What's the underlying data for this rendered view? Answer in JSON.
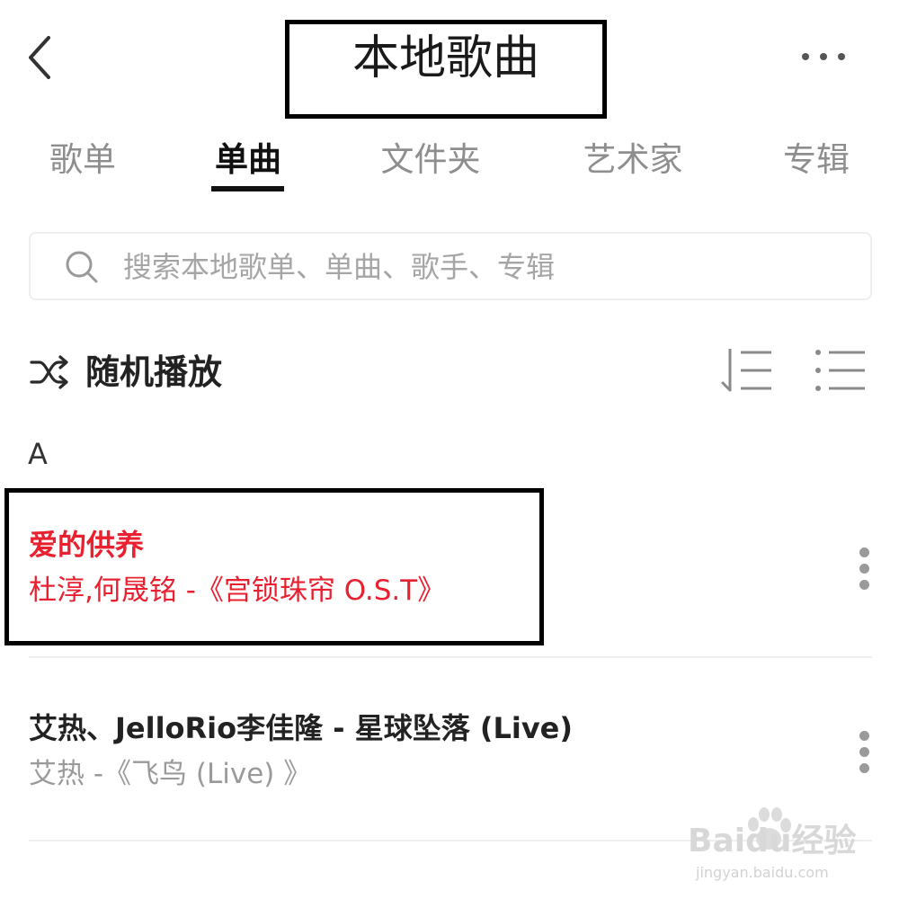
{
  "header": {
    "title": "本地歌曲",
    "back_icon": "chevron-left-icon",
    "more_icon": "more-horizontal-icon"
  },
  "tabs": [
    {
      "label": "歌单",
      "active": false
    },
    {
      "label": "单曲",
      "active": true
    },
    {
      "label": "文件夹",
      "active": false
    },
    {
      "label": "艺术家",
      "active": false
    },
    {
      "label": "专辑",
      "active": false
    }
  ],
  "search": {
    "placeholder": "搜索本地歌单、单曲、歌手、专辑",
    "icon": "search-icon"
  },
  "actions": {
    "shuffle_label": "随机播放",
    "shuffle_icon": "shuffle-icon",
    "sort_icon": "sort-icon",
    "list_icon": "list-icon"
  },
  "section_letter": "A",
  "songs": [
    {
      "title": "爱的供养",
      "subtitle": "杜淳,何晟铭 -《宫锁珠帘 O.S.T》",
      "playing": true
    },
    {
      "title": "艾热、JelloRio李佳隆 - 星球坠落 (Live)",
      "subtitle": "艾热 -《飞鸟 (Live) 》",
      "playing": false
    }
  ],
  "watermark": {
    "logo": "Baidu经验",
    "url": "jingyan.baidu.com"
  },
  "colors": {
    "accent_red": "#e8202f",
    "text_primary": "#222222",
    "text_secondary": "#8e8e8e",
    "divider": "#eeeeee"
  }
}
